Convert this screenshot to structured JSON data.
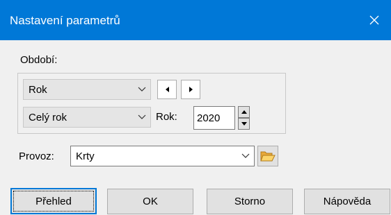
{
  "window": {
    "title": "Nastavení parametrů",
    "close_icon": "close-icon"
  },
  "period": {
    "label": "Období:",
    "type_value": "Rok",
    "range_value": "Celý rok",
    "year_label": "Rok:",
    "year_value": "2020"
  },
  "provoz": {
    "label": "Provoz:",
    "value": "Krty",
    "browse_icon": "folder-open-icon"
  },
  "buttons": {
    "overview": "Přehled",
    "ok": "OK",
    "cancel": "Storno",
    "help": "Nápověda"
  },
  "colors": {
    "titlebar": "#0078d7",
    "dialog_bg": "#f0f0f0",
    "button_bg": "#e1e1e1"
  }
}
